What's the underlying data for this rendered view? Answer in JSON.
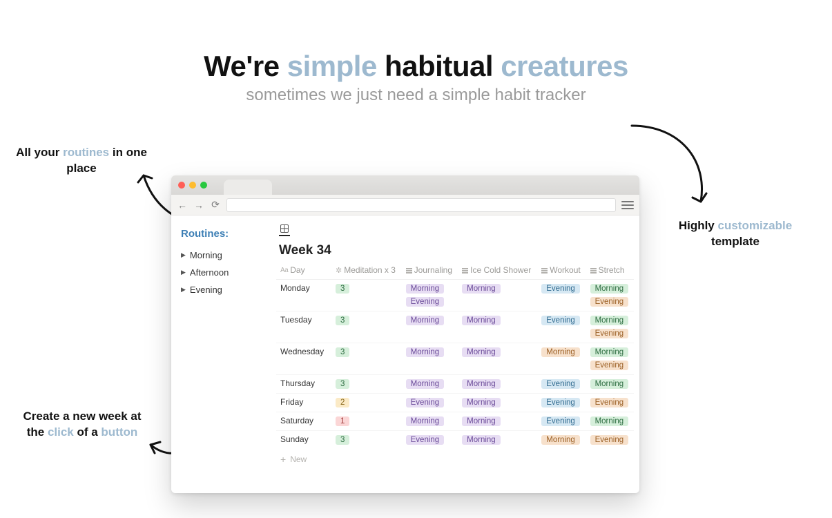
{
  "headline": {
    "w1": "We're ",
    "w2": "simple",
    "w3": " habitual ",
    "w4": "creatures"
  },
  "subhead": "sometimes we just need a simple habit tracker",
  "callouts": {
    "left1_a": "All your ",
    "left1_b": "routines",
    "left1_c": " in one place",
    "left2_a": "Create a new week at the ",
    "left2_b": "click",
    "left2_c": " of a ",
    "left2_d": "button",
    "right_a": "Highly ",
    "right_b": "customizable",
    "right_c": " template"
  },
  "sidebar": {
    "title": "Routines:",
    "items": [
      "Morning",
      "Afternoon",
      "Evening"
    ]
  },
  "table": {
    "title": "Week 34",
    "columns": [
      "Day",
      "Meditation x 3",
      "Journaling",
      "Ice Cold Shower",
      "Workout",
      "Stretch"
    ],
    "rows": [
      {
        "day": "Monday",
        "med": {
          "v": "3",
          "c": "green"
        },
        "jour": [
          "Morning",
          "Evening"
        ],
        "jour_c": [
          "purple",
          "purple"
        ],
        "ice": [
          "Morning"
        ],
        "ice_c": [
          "purple"
        ],
        "work": [
          "Evening"
        ],
        "work_c": [
          "blue"
        ],
        "str": [
          "Morning",
          "Evening"
        ],
        "str_c": [
          "green",
          "orange"
        ]
      },
      {
        "day": "Tuesday",
        "med": {
          "v": "3",
          "c": "green"
        },
        "jour": [
          "Morning"
        ],
        "jour_c": [
          "purple"
        ],
        "ice": [
          "Morning"
        ],
        "ice_c": [
          "purple"
        ],
        "work": [
          "Evening"
        ],
        "work_c": [
          "blue"
        ],
        "str": [
          "Morning",
          "Evening"
        ],
        "str_c": [
          "green",
          "orange"
        ]
      },
      {
        "day": "Wednesday",
        "med": {
          "v": "3",
          "c": "green"
        },
        "jour": [
          "Morning"
        ],
        "jour_c": [
          "purple"
        ],
        "ice": [
          "Morning"
        ],
        "ice_c": [
          "purple"
        ],
        "work": [
          "Morning"
        ],
        "work_c": [
          "orange"
        ],
        "str": [
          "Morning",
          "Evening"
        ],
        "str_c": [
          "green",
          "orange"
        ]
      },
      {
        "day": "Thursday",
        "med": {
          "v": "3",
          "c": "green"
        },
        "jour": [
          "Morning"
        ],
        "jour_c": [
          "purple"
        ],
        "ice": [
          "Morning"
        ],
        "ice_c": [
          "purple"
        ],
        "work": [
          "Evening"
        ],
        "work_c": [
          "blue"
        ],
        "str": [
          "Morning"
        ],
        "str_c": [
          "green"
        ]
      },
      {
        "day": "Friday",
        "med": {
          "v": "2",
          "c": "yellow"
        },
        "jour": [
          "Evening"
        ],
        "jour_c": [
          "purple"
        ],
        "ice": [
          "Morning"
        ],
        "ice_c": [
          "purple"
        ],
        "work": [
          "Evening"
        ],
        "work_c": [
          "blue"
        ],
        "str": [
          "Evening"
        ],
        "str_c": [
          "orange"
        ]
      },
      {
        "day": "Saturday",
        "med": {
          "v": "1",
          "c": "red"
        },
        "jour": [
          "Morning"
        ],
        "jour_c": [
          "purple"
        ],
        "ice": [
          "Morning"
        ],
        "ice_c": [
          "purple"
        ],
        "work": [
          "Evening"
        ],
        "work_c": [
          "blue"
        ],
        "str": [
          "Morning"
        ],
        "str_c": [
          "green"
        ]
      },
      {
        "day": "Sunday",
        "med": {
          "v": "3",
          "c": "green"
        },
        "jour": [
          "Evening"
        ],
        "jour_c": [
          "purple"
        ],
        "ice": [
          "Morning"
        ],
        "ice_c": [
          "purple"
        ],
        "work": [
          "Morning"
        ],
        "work_c": [
          "orange"
        ],
        "str": [
          "Evening"
        ],
        "str_c": [
          "orange"
        ]
      }
    ],
    "new_label": "New"
  }
}
